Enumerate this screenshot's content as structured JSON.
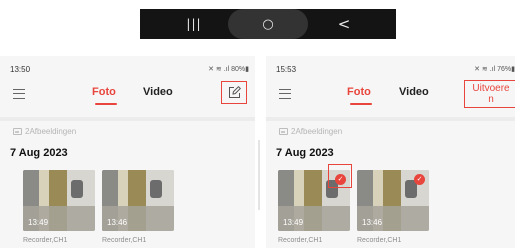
{
  "navbar": {
    "recents_glyph": "|||",
    "home_glyph": "○",
    "back_glyph": "<"
  },
  "left": {
    "status_time": "13:50",
    "status_icons": "✕ ≋ .ıl 80%▮",
    "tabs": [
      "Foto",
      "Video"
    ],
    "album_label": "2Afbeeldingen",
    "date": "7 Aug 2023",
    "thumbs": [
      {
        "duration": "13:49",
        "caption": "Recorder,CH1"
      },
      {
        "duration": "13:46",
        "caption": "Recorder,CH1"
      }
    ],
    "edit_icon": "edit-square-icon"
  },
  "right": {
    "status_time": "15:53",
    "status_icons": "✕ ≋ .ıl 76%▮",
    "tabs": [
      "Foto",
      "Video"
    ],
    "action_label_line1": "Uitvoere",
    "action_label_line2": "n",
    "album_label": "2Afbeeldingen",
    "date": "7 Aug 2023",
    "thumbs": [
      {
        "duration": "13:49",
        "caption": "Recorder,CH1"
      },
      {
        "duration": "13:46",
        "caption": "Recorder,CH1"
      }
    ],
    "select_glyph": "✓"
  },
  "colors": {
    "accent": "#e8453c",
    "navbar": "#141414",
    "background": "#f6f6f6"
  }
}
